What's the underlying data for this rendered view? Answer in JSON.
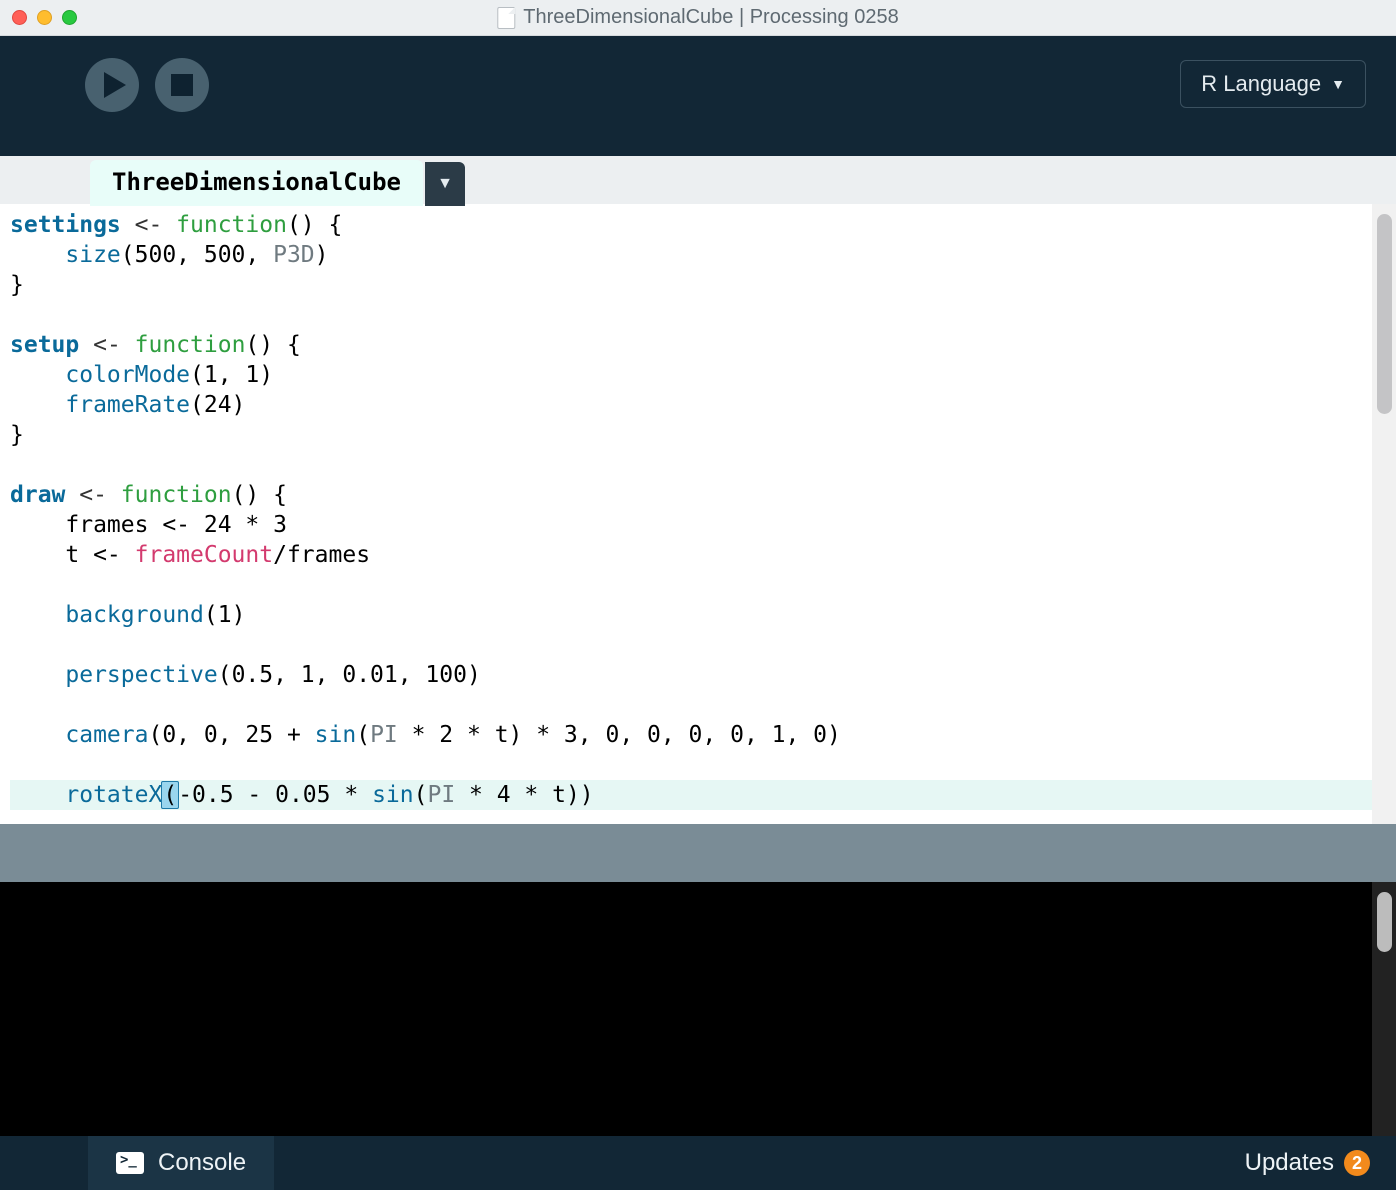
{
  "window": {
    "title": "ThreeDimensionalCube | Processing 0258"
  },
  "toolbar": {
    "language_label": "R Language"
  },
  "tabs": {
    "active": "ThreeDimensionalCube"
  },
  "code": {
    "lines": [
      [
        {
          "t": "settings",
          "c": "tok-def"
        },
        {
          "t": " <- ",
          "c": "tok-assign"
        },
        {
          "t": "function",
          "c": "tok-func"
        },
        {
          "t": "() {",
          "c": ""
        }
      ],
      [
        {
          "t": "    ",
          "c": ""
        },
        {
          "t": "size",
          "c": "tok-call"
        },
        {
          "t": "(500, 500, ",
          "c": ""
        },
        {
          "t": "P3D",
          "c": "tok-const"
        },
        {
          "t": ")",
          "c": ""
        }
      ],
      [
        {
          "t": "}",
          "c": ""
        }
      ],
      [
        {
          "t": "",
          "c": ""
        }
      ],
      [
        {
          "t": "setup",
          "c": "tok-def"
        },
        {
          "t": " <- ",
          "c": "tok-assign"
        },
        {
          "t": "function",
          "c": "tok-func"
        },
        {
          "t": "() {",
          "c": ""
        }
      ],
      [
        {
          "t": "    ",
          "c": ""
        },
        {
          "t": "colorMode",
          "c": "tok-call"
        },
        {
          "t": "(1, 1)",
          "c": ""
        }
      ],
      [
        {
          "t": "    ",
          "c": ""
        },
        {
          "t": "frameRate",
          "c": "tok-call"
        },
        {
          "t": "(24)",
          "c": ""
        }
      ],
      [
        {
          "t": "}",
          "c": ""
        }
      ],
      [
        {
          "t": "",
          "c": ""
        }
      ],
      [
        {
          "t": "draw",
          "c": "tok-def"
        },
        {
          "t": " <- ",
          "c": "tok-assign"
        },
        {
          "t": "function",
          "c": "tok-func"
        },
        {
          "t": "() {",
          "c": ""
        }
      ],
      [
        {
          "t": "    frames <- 24 * 3",
          "c": ""
        }
      ],
      [
        {
          "t": "    t <- ",
          "c": ""
        },
        {
          "t": "frameCount",
          "c": "tok-var"
        },
        {
          "t": "/frames",
          "c": ""
        }
      ],
      [
        {
          "t": "",
          "c": ""
        }
      ],
      [
        {
          "t": "    ",
          "c": ""
        },
        {
          "t": "background",
          "c": "tok-call"
        },
        {
          "t": "(1)",
          "c": ""
        }
      ],
      [
        {
          "t": "",
          "c": ""
        }
      ],
      [
        {
          "t": "    ",
          "c": ""
        },
        {
          "t": "perspective",
          "c": "tok-call"
        },
        {
          "t": "(0.5, 1, 0.01, 100)",
          "c": ""
        }
      ],
      [
        {
          "t": "",
          "c": ""
        }
      ],
      [
        {
          "t": "    ",
          "c": ""
        },
        {
          "t": "camera",
          "c": "tok-call"
        },
        {
          "t": "(0, 0, 25 + ",
          "c": ""
        },
        {
          "t": "sin",
          "c": "tok-call"
        },
        {
          "t": "(",
          "c": ""
        },
        {
          "t": "PI",
          "c": "tok-const"
        },
        {
          "t": " * 2 * t) * 3, 0, 0, 0, 0, 1, 0)",
          "c": ""
        }
      ],
      [
        {
          "t": "",
          "c": ""
        }
      ]
    ],
    "highlighted_line": {
      "tokens": [
        {
          "t": "    ",
          "c": ""
        },
        {
          "t": "rotateX",
          "c": "tok-call"
        },
        {
          "t": "(",
          "c": "paren-hl"
        },
        {
          "t": "-0.5 - 0.05 * ",
          "c": ""
        },
        {
          "t": "sin",
          "c": "tok-call"
        },
        {
          "t": "(",
          "c": ""
        },
        {
          "t": "PI",
          "c": "tok-const"
        },
        {
          "t": " * 4 * t))",
          "c": ""
        }
      ]
    }
  },
  "bottom": {
    "console_label": "Console",
    "updates_label": "Updates",
    "updates_count": "2"
  }
}
